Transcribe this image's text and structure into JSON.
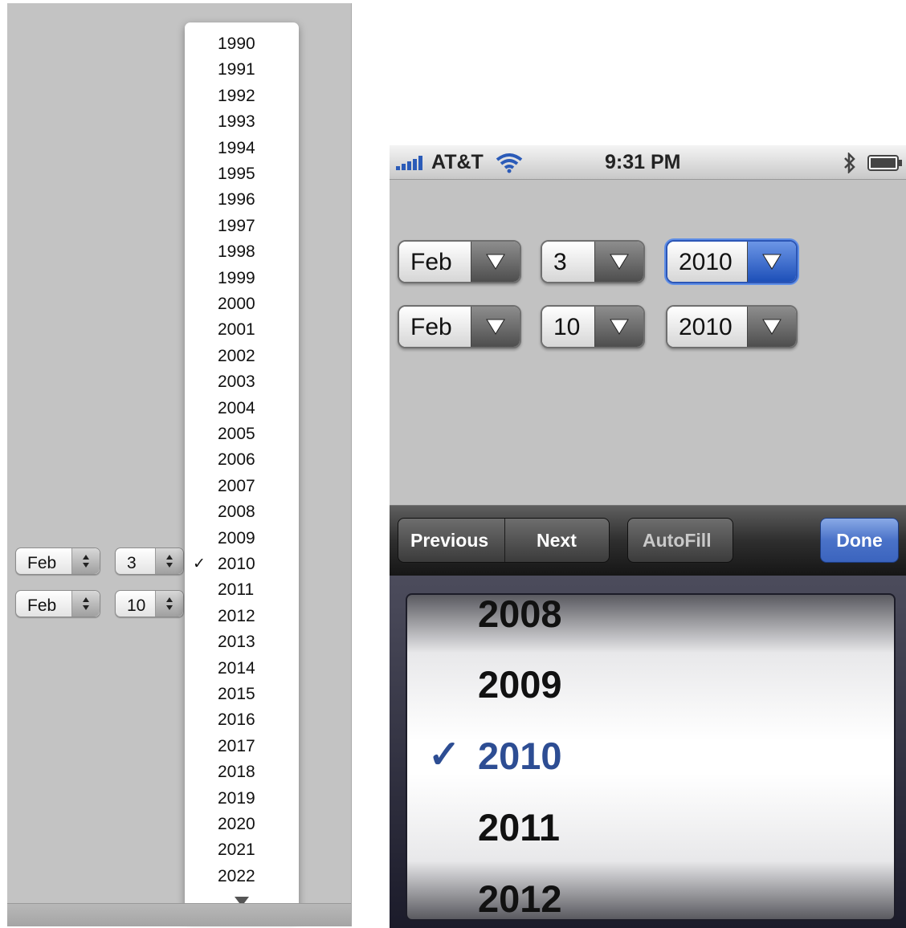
{
  "desktop": {
    "row1": {
      "month": "Feb",
      "day": "3"
    },
    "row2": {
      "month": "Feb",
      "day": "10"
    },
    "year_menu": {
      "years": [
        "1990",
        "1991",
        "1992",
        "1993",
        "1994",
        "1995",
        "1996",
        "1997",
        "1998",
        "1999",
        "2000",
        "2001",
        "2002",
        "2003",
        "2004",
        "2005",
        "2006",
        "2007",
        "2008",
        "2009",
        "2010",
        "2011",
        "2012",
        "2013",
        "2014",
        "2015",
        "2016",
        "2017",
        "2018",
        "2019",
        "2020",
        "2021",
        "2022"
      ],
      "selected": "2010",
      "check_mark": "✓"
    }
  },
  "phone": {
    "status_bar": {
      "carrier": "AT&T",
      "time": "9:31 PM"
    },
    "row1": {
      "month": "Feb",
      "day": "3",
      "year": "2010"
    },
    "row2": {
      "month": "Feb",
      "day": "10",
      "year": "2010"
    },
    "toolbar": {
      "previous": "Previous",
      "next": "Next",
      "autofill": "AutoFill",
      "done": "Done"
    },
    "picker": {
      "years": [
        "2008",
        "2009",
        "2010",
        "2011",
        "2012"
      ],
      "selected": "2010",
      "check_mark": "✓"
    }
  },
  "colors": {
    "accent": "#2d4d93",
    "done": "#4a72c8"
  }
}
